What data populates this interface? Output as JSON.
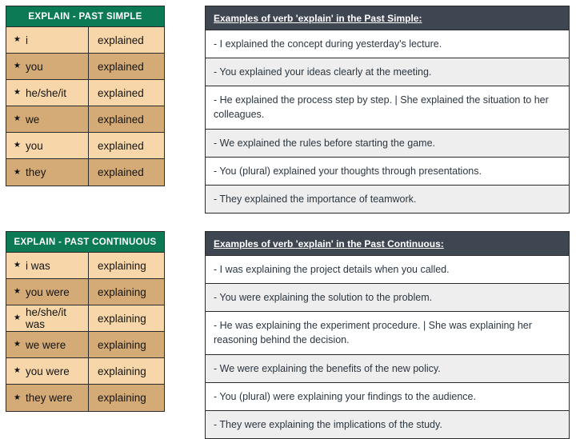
{
  "colors": {
    "table_header_green": "#0d7a56",
    "row_light": "#f7d7aa",
    "row_dark": "#d4ab77",
    "panel_header_slate": "#3e4652",
    "ex_row_light": "#ffffff",
    "ex_row_gray": "#eeeeee",
    "border": "#2a2a2a",
    "text_dark": "#141414",
    "text_slate": "#2b3640"
  },
  "icons": {
    "bullet": "star-icon",
    "bullet_glyph": "★"
  },
  "sections": [
    {
      "id": "past-simple",
      "table": {
        "title": "EXPLAIN - PAST SIMPLE",
        "rows": [
          {
            "pronoun": "i",
            "verb": "explained"
          },
          {
            "pronoun": "you",
            "verb": "explained"
          },
          {
            "pronoun": "he/she/it",
            "verb": "explained"
          },
          {
            "pronoun": "we",
            "verb": "explained"
          },
          {
            "pronoun": "you",
            "verb": "explained"
          },
          {
            "pronoun": "they",
            "verb": "explained"
          }
        ]
      },
      "examples": {
        "title": "Examples of verb 'explain' in the Past Simple:",
        "items": [
          "- I explained the concept during yesterday's lecture.",
          "- You explained your ideas clearly at the meeting.",
          "- He explained the process step by step. | She explained the situation to her colleagues.",
          "- We explained the rules before starting the game.",
          "- You (plural) explained your thoughts through presentations.",
          "- They explained the importance of teamwork."
        ]
      }
    },
    {
      "id": "past-continuous",
      "table": {
        "title": "EXPLAIN - PAST CONTINUOUS",
        "rows": [
          {
            "pronoun": "i was",
            "verb": "explaining"
          },
          {
            "pronoun": "you were",
            "verb": "explaining"
          },
          {
            "pronoun": "he/she/it was",
            "verb": "explaining"
          },
          {
            "pronoun": "we were",
            "verb": "explaining"
          },
          {
            "pronoun": "you were",
            "verb": "explaining"
          },
          {
            "pronoun": "they were",
            "verb": "explaining"
          }
        ]
      },
      "examples": {
        "title": "Examples of verb 'explain' in the Past Continuous:",
        "items": [
          "- I was explaining the project details when you called.",
          "- You were explaining the solution to the problem.",
          "- He was explaining the experiment procedure. | She was explaining her reasoning behind the decision.",
          "- We were explaining the benefits of the new policy.",
          "- You (plural) were explaining your findings to the audience.",
          "- They were explaining the implications of the study."
        ]
      }
    }
  ]
}
